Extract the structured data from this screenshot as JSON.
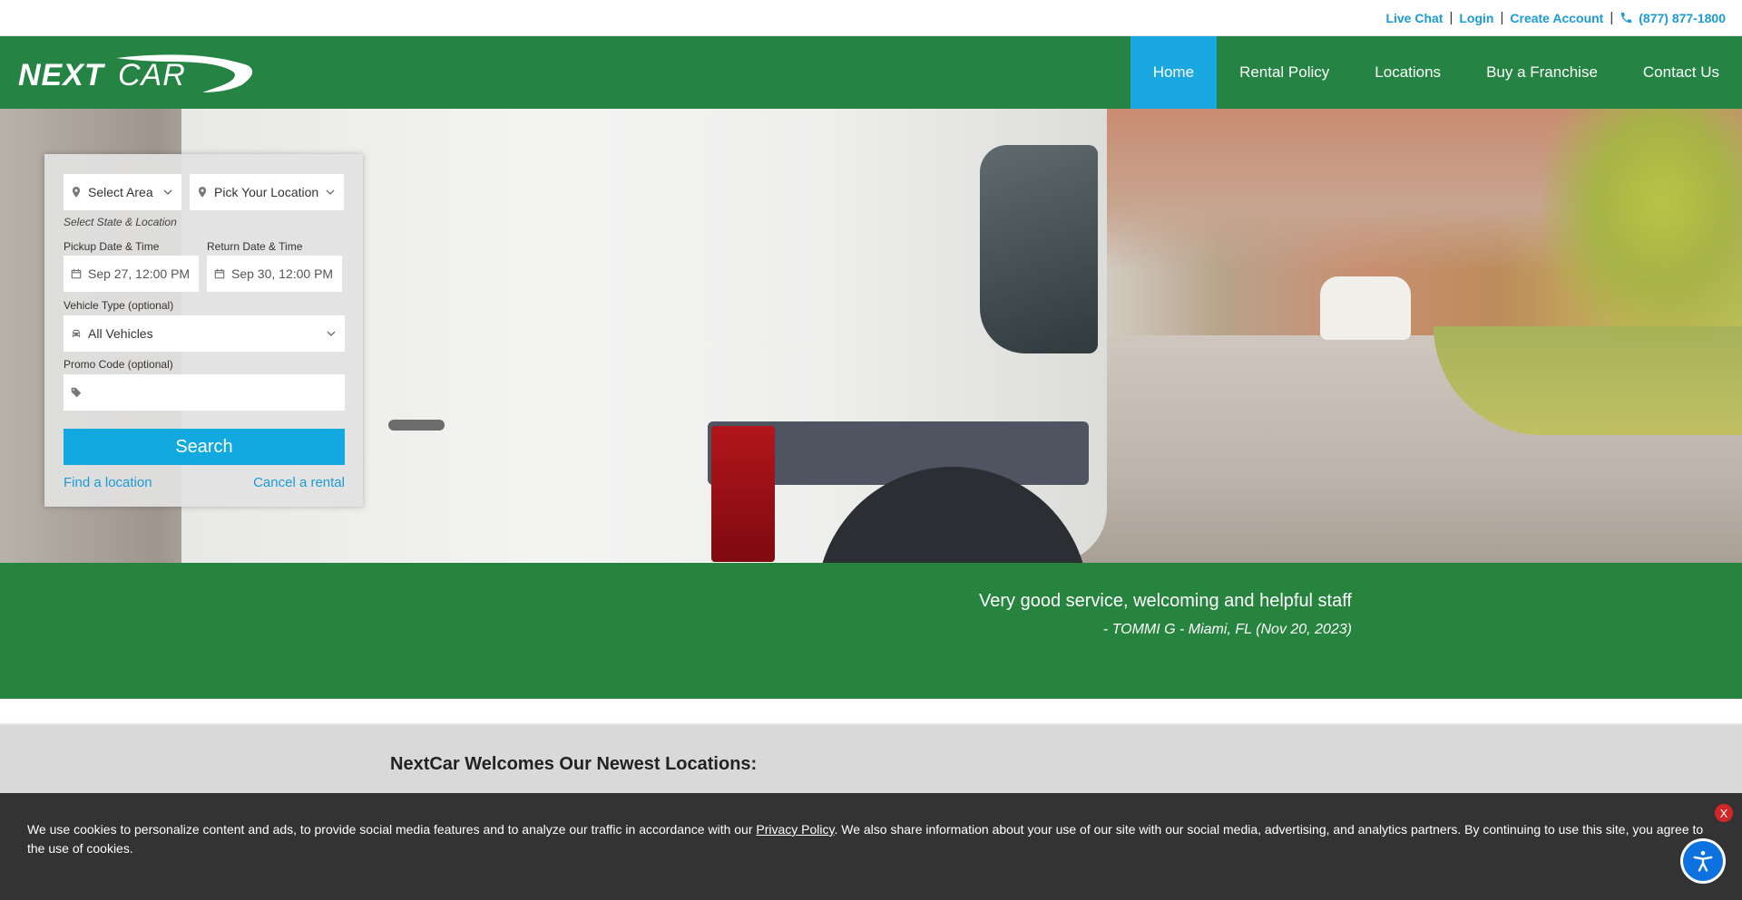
{
  "utility": {
    "live_chat": "Live Chat",
    "login": "Login",
    "create_account": "Create Account",
    "phone": "(877) 877-1800",
    "phone_icon": "phone-icon"
  },
  "header": {
    "logo_text": "NEXTCAR",
    "nav": [
      {
        "label": "Home",
        "active": true
      },
      {
        "label": "Rental Policy",
        "active": false
      },
      {
        "label": "Locations",
        "active": false
      },
      {
        "label": "Buy a Franchise",
        "active": false
      },
      {
        "label": "Contact Us",
        "active": false
      }
    ]
  },
  "booking": {
    "area_select": "Select Area",
    "location_select": "Pick Your Location",
    "location_hint": "Select State & Location",
    "pickup_label": "Pickup Date & Time",
    "pickup_value": "Sep 27, 12:00 PM",
    "return_label": "Return Date & Time",
    "return_value": "Sep 30, 12:00 PM",
    "vehicle_label": "Vehicle Type (optional)",
    "vehicle_value": "All Vehicles",
    "promo_label": "Promo Code (optional)",
    "promo_value": "",
    "search_label": "Search",
    "find_location": "Find a location",
    "cancel_rental": "Cancel a rental"
  },
  "testimonial": {
    "quote": "Very good service, welcoming and helpful staff",
    "author": "- TOMMI G - Miami, FL (Nov 20, 2023)"
  },
  "newest": {
    "title": "NextCar Welcomes Our Newest Locations:"
  },
  "cookie": {
    "text_before": "We use cookies to personalize content and ads, to provide social media features and to analyze our traffic in accordance with our ",
    "privacy_link": "Privacy Policy",
    "text_after": ". We also share information about your use of our site with our social media, advertising, and analytics partners. By continuing to use this site, you agree to the use of cookies.",
    "close_label": "X"
  },
  "colors": {
    "brand_green": "#258444",
    "accent_blue": "#1aa8e0",
    "cookie_bg": "#333333"
  }
}
